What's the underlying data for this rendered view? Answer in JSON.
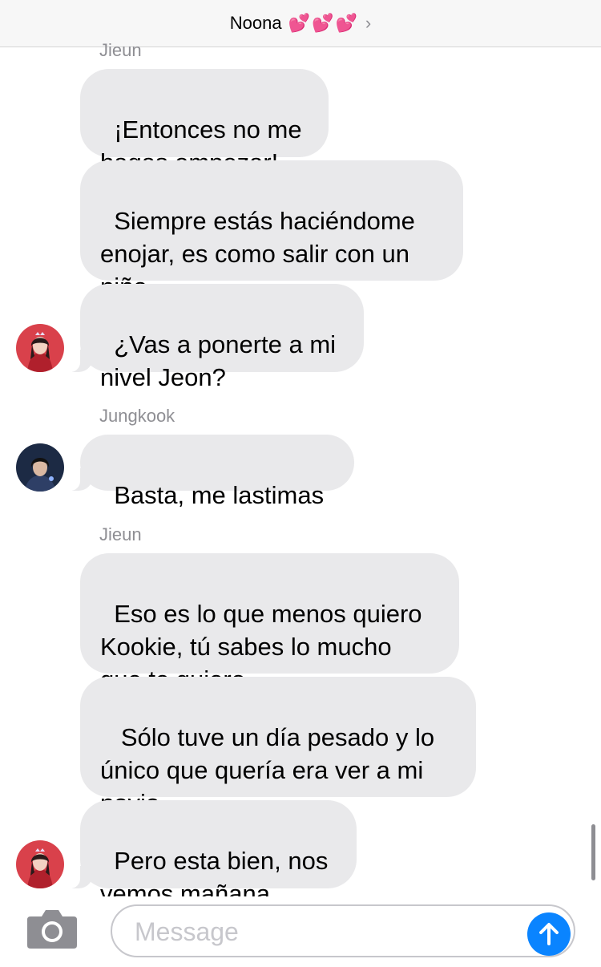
{
  "header": {
    "title": "Noona",
    "hearts": [
      "💕",
      "💕",
      "💕"
    ],
    "chevron_icon": "chevron-right-icon"
  },
  "messages": [
    {
      "type": "sender",
      "text": "Jieun"
    },
    {
      "type": "bubble",
      "text": "¡Entonces no me\nhagas empezar!"
    },
    {
      "type": "bubble",
      "text": "Siempre estás haciéndome\nenojar, es como salir con un\nniño"
    },
    {
      "type": "bubble",
      "text": "¿Vas a ponerte a mi\nnivel Jeon?",
      "avatar": "jieun-avatar"
    },
    {
      "type": "sender",
      "text": "Jungkook"
    },
    {
      "type": "bubble",
      "text": "Basta, me lastimas",
      "avatar": "jungkook-avatar"
    },
    {
      "type": "sender",
      "text": "Jieun"
    },
    {
      "type": "bubble",
      "text": "Eso es lo que menos quiero\nKookie, tú sabes lo mucho\nque te quiero"
    },
    {
      "type": "bubble",
      "text": " Sólo tuve un día pesado y lo\núnico que quería era ver a mi\nnovio"
    },
    {
      "type": "bubble",
      "text": "Pero esta bien, nos\nvemos mañana",
      "avatar": "jieun-avatar"
    }
  ],
  "composer": {
    "placeholder": "Message",
    "value": "",
    "camera_icon": "camera-icon",
    "send_icon": "send-arrow-up-icon"
  },
  "colors": {
    "bubble_gray": "#e9e9eb",
    "send_blue": "#0a84ff",
    "heart_pink": "#ff4fa3"
  }
}
